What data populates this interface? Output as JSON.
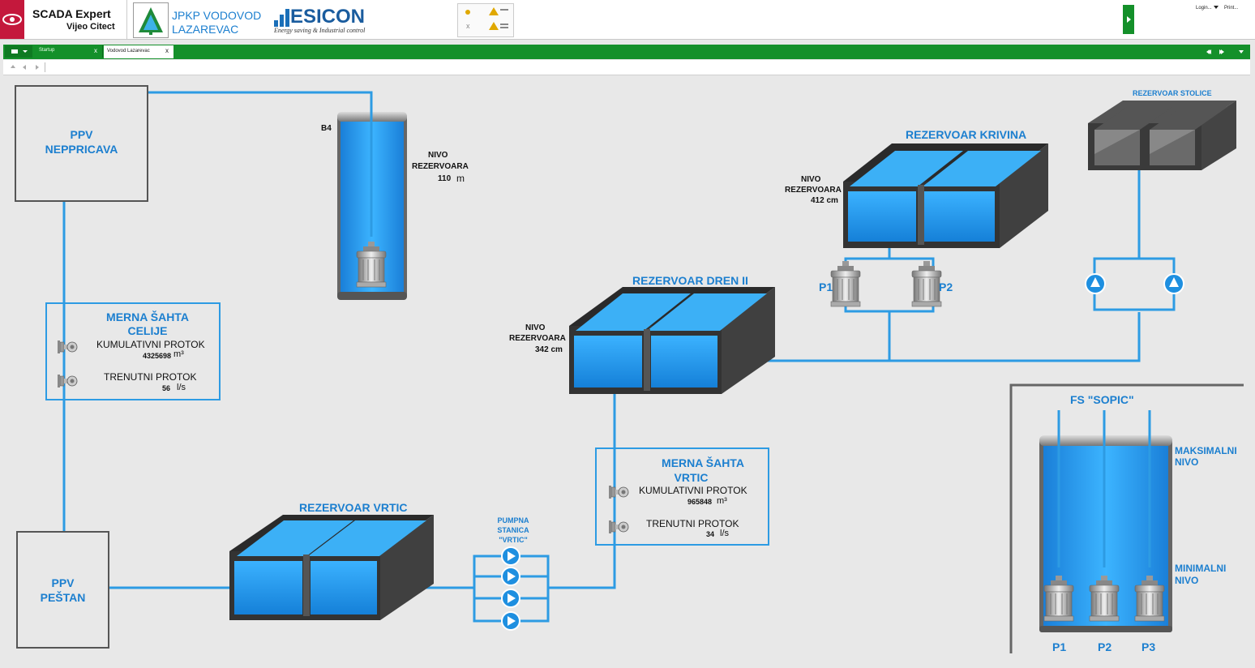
{
  "header": {
    "app_name": "SCADA Expert",
    "app_sub": "Vijeo Citect",
    "org_line1": "JPKP VODOVOD",
    "org_line2": "LAZAREVAC",
    "esicon_name": "ESICON",
    "esicon_tagline": "Energy saving & Industrial control",
    "login_label": "Login...",
    "print_label": "Print..."
  },
  "tabs": {
    "menu_icon": "menu-icon",
    "tab1_label": "Startup",
    "tab2_label": "Vodovod Lazarevac",
    "close_glyph": "x"
  },
  "colors": {
    "accent_green": "#14902a",
    "water_blue": "#1c9be8",
    "pipe_blue": "#2d9be3",
    "label_blue": "#1c7fcf"
  },
  "plant": {
    "ppv_nep_l1": "PPV",
    "ppv_nep_l2": "NEPPRICAVA",
    "ppv_pes_l1": "PPV",
    "ppv_pes_l2": "PEŠTAN",
    "b4_label": "B4",
    "b4_level_l1": "NIVO",
    "b4_level_l2": "REZERVOARA",
    "b4_level_value": "110",
    "b4_level_unit": "m",
    "merna_celije_title_l1": "MERNA ŠAHTA",
    "merna_celije_title_l2": "CELIJE",
    "cumul_label": "KUMULATIVNI PROTOK",
    "celije_cumul_value": "4325698",
    "cumul_unit": "m³",
    "trenutni_label": "TRENUTNI PROTOK",
    "celije_trenutni_value": "56",
    "flow_unit": "l/s",
    "merna_vrtic_title_l1": "MERNA ŠAHTA",
    "merna_vrtic_title_l2": "VRTIC",
    "vrtic_cumul_value": "965848",
    "vrtic_trenutni_value": "34",
    "rez_vrtic_title": "REZERVOAR VRTIC",
    "pumpna_l1": "PUMPNA",
    "pumpna_l2": "STANICA",
    "pumpna_l3": "\"VRTIC\"",
    "rez_dren_title": "REZERVOAR DREN II",
    "dren_level_l1": "NIVO",
    "dren_level_l2": "REZERVOARA",
    "dren_level_value": "342 cm",
    "rez_krivina_title": "REZERVOAR KRIVINA",
    "krivina_level_l1": "NIVO",
    "krivina_level_l2": "REZERVOARA",
    "krivina_level_value": "412 cm",
    "krivina_p1": "P1",
    "krivina_p2": "P2",
    "rez_stolice_title": "REZERVOAR STOLICE",
    "fs_title": "FS \"SOPIC\"",
    "max_l1": "MAKSIMALNI",
    "max_l2": "NIVO",
    "min_l1": "MINIMALNI",
    "min_l2": "NIVO",
    "fs_p1": "P1",
    "fs_p2": "P2",
    "fs_p3": "P3"
  }
}
